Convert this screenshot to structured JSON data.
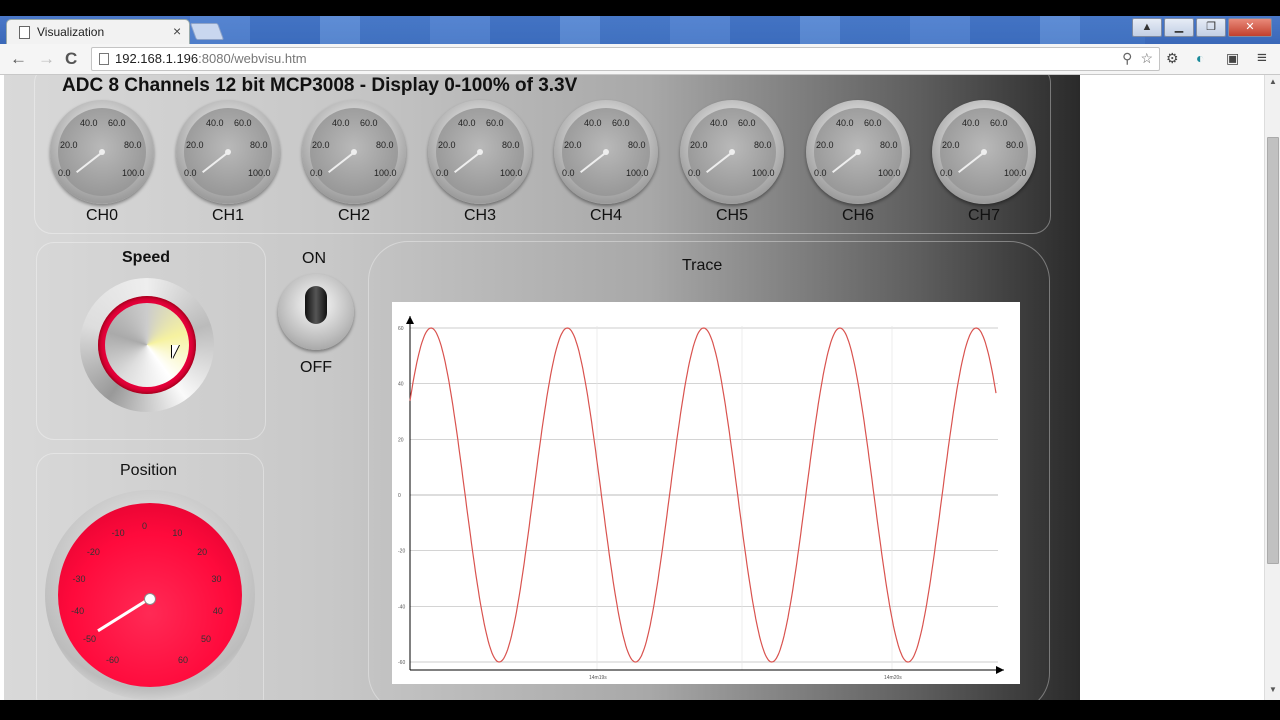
{
  "browser": {
    "tab_title": "Visualization",
    "tab_close": "×",
    "url_host": "192.168.1.196",
    "url_rest": ":8080/webvisu.htm",
    "nav_back": "←",
    "nav_forward": "→",
    "nav_reload": "C",
    "menu": "≡"
  },
  "header": {
    "title": "ADC 8 Channels 12 bit MCP3008  - Display 0-100% of 3.3V"
  },
  "channels": [
    {
      "label": "CH0"
    },
    {
      "label": "CH1"
    },
    {
      "label": "CH2"
    },
    {
      "label": "CH3"
    },
    {
      "label": "CH4"
    },
    {
      "label": "CH5"
    },
    {
      "label": "CH6"
    },
    {
      "label": "CH7"
    }
  ],
  "gauge_ticks": {
    "t0": "0.0",
    "t20": "20.0",
    "t40": "40.0",
    "t60": "60.0",
    "t80": "80.0",
    "t100": "100.0"
  },
  "speed": {
    "label": "Speed"
  },
  "switch": {
    "on": "ON",
    "off": "OFF"
  },
  "position": {
    "label": "Position",
    "ticks": [
      "-60",
      "-50",
      "-40",
      "-30",
      "-20",
      "-10",
      "0",
      "10",
      "20",
      "30",
      "40",
      "50",
      "60"
    ]
  },
  "trace": {
    "label": "Trace"
  },
  "chart_data": {
    "type": "line",
    "title": "Trace",
    "xlabel": "",
    "ylabel": "",
    "ylim": [
      -60,
      60
    ],
    "yticks": [
      "60",
      "40",
      "20",
      "0",
      "-20",
      "-40",
      "-60"
    ],
    "xticks": [
      "14m19s",
      "14m20s"
    ],
    "series": [
      {
        "color": "#d9534f",
        "shape": "sine",
        "amplitude": 60,
        "periods": 4.3,
        "phase": 0.6
      }
    ]
  },
  "colors": {
    "accent": "#ff0a3c",
    "trace": "#d9534f"
  }
}
